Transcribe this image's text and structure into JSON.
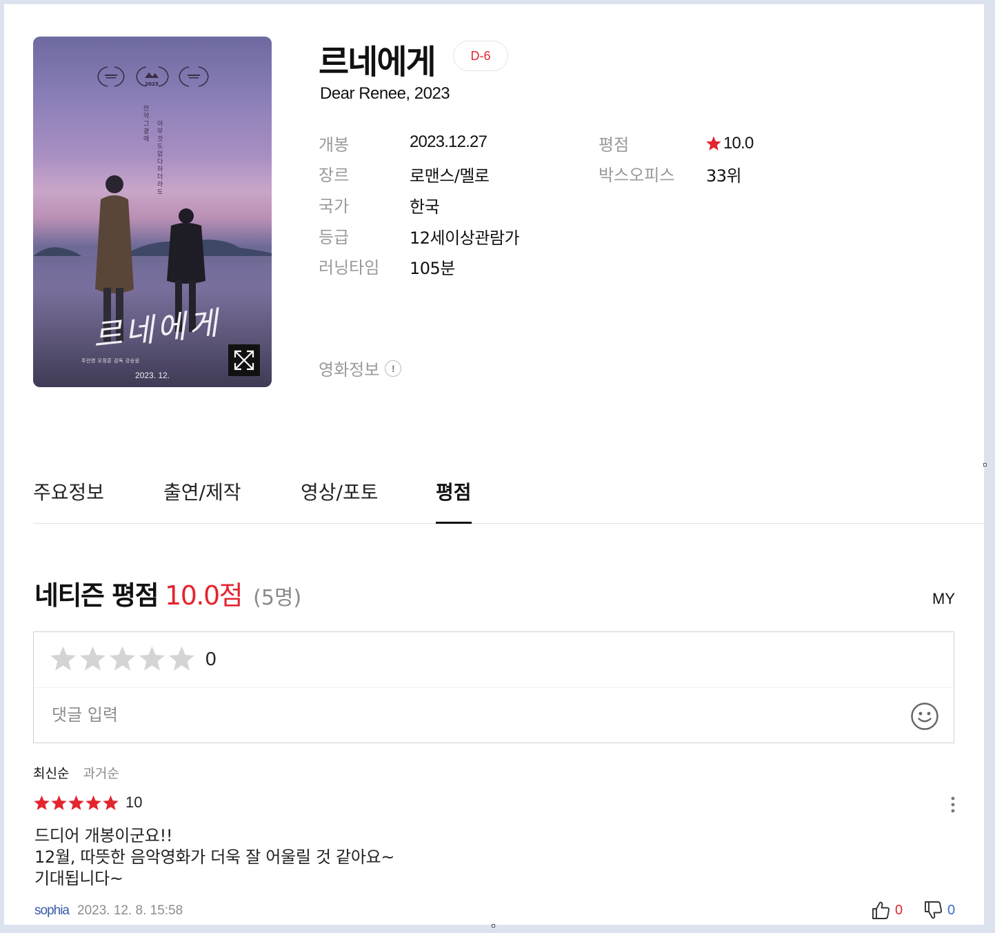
{
  "movie": {
    "title": "르네에게",
    "dday": "D-6",
    "subtitle": "Dear Renee, 2023",
    "poster": {
      "title_art": "르네에게",
      "tagline_1": "만약 그 곁에",
      "tagline_2": "아무것도 없다 하더라도",
      "credits": "주인영 오정훈 감독 강승원",
      "date": "2023. 12.",
      "laurel_year": "2023"
    },
    "info_left": [
      {
        "label": "개봉",
        "value": "2023.12.27"
      },
      {
        "label": "장르",
        "value": "로맨스/멜로"
      },
      {
        "label": "국가",
        "value": "한국"
      },
      {
        "label": "등급",
        "value": "12세이상관람가"
      },
      {
        "label": "러닝타임",
        "value": "105분"
      }
    ],
    "info_right": [
      {
        "label": "평점",
        "value": "10.0"
      },
      {
        "label": "박스오피스",
        "value": "33위"
      }
    ],
    "movie_info_link": "영화정보",
    "info_icon": "!"
  },
  "tabs": [
    {
      "label": "주요정보",
      "active": false
    },
    {
      "label": "출연/제작",
      "active": false
    },
    {
      "label": "영상/포토",
      "active": false
    },
    {
      "label": "평점",
      "active": true
    }
  ],
  "ratings": {
    "heading": "네티즌 평점",
    "score": "10.0점",
    "count": "(5명)",
    "my_link": "MY",
    "input": {
      "star_value": "0",
      "placeholder": "댓글 입력",
      "value": ""
    },
    "sort": {
      "latest": "최신순",
      "oldest": "과거순"
    },
    "reviews": [
      {
        "stars": 5,
        "score": "10",
        "text": "드디어 개봉이군요!!\n12월, 따뜻한 음악영화가 더욱 잘 어울릴 것 같아요~\n기대됩니다~",
        "author": "sophia",
        "date": "2023. 12. 8. 15:58",
        "likes": "0",
        "dislikes": "0"
      }
    ]
  },
  "colors": {
    "accent_red": "#e3252f",
    "author_blue": "#3a5ba8",
    "dislike_blue": "#3a6cc8",
    "muted_gray": "#9a9a9a",
    "empty_star": "#d4d4d4"
  }
}
